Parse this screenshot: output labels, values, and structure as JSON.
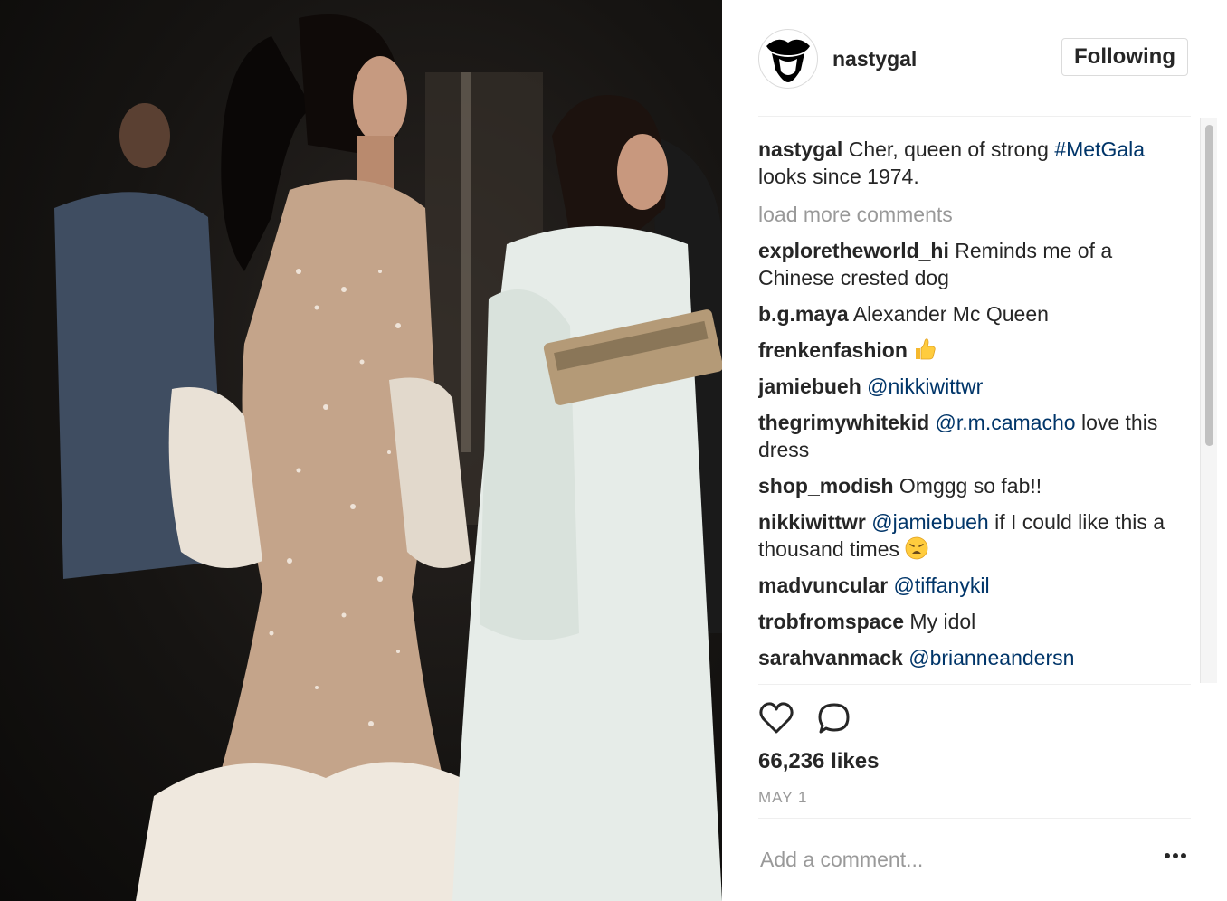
{
  "post": {
    "image_alt": "Photo of two women in evening gowns at a gala",
    "author": "nastygal",
    "follow_label": "Following"
  },
  "caption": {
    "user": "nastygal",
    "text_before": " Cher, queen of strong ",
    "hashtag": "#MetGala",
    "text_after": " looks since 1974."
  },
  "load_more": "load more comments",
  "comments": [
    {
      "user": "exploretheworld_hi",
      "text": " Reminds me of a Chinese crested dog"
    },
    {
      "user": "b.g.maya",
      "text": " Alexander Mc Queen"
    },
    {
      "user": "frenkenfashion",
      "text": " ",
      "emoji": "thumbs-up"
    },
    {
      "user": "jamiebueh",
      "mention": "@nikkiwittwr"
    },
    {
      "user": "thegrimywhitekid",
      "mention": "@r.m.camacho",
      "text": " love this dress"
    },
    {
      "user": "shop_modish",
      "text": " Omggg so fab!!"
    },
    {
      "user": "nikkiwittwr",
      "mention": "@jamiebueh",
      "text": " if I could like this a thousand times ",
      "emoji": "weary-face"
    },
    {
      "user": "madvuncular",
      "mention": "@tiffanykil"
    },
    {
      "user": "trobfromspace",
      "text": " My idol"
    },
    {
      "user": "sarahvanmack",
      "mention": "@brianneandersn"
    }
  ],
  "likes": "66,236 likes",
  "date": "MAY 1",
  "add_comment_placeholder": "Add a comment...",
  "more_glyph": "•••",
  "icons": {
    "like": "heart-icon",
    "comment": "comment-icon",
    "more": "more-options-icon",
    "thumbs": "thumbs-up-icon",
    "weary": "weary-face-icon"
  },
  "colors": {
    "text": "#262626",
    "link": "#003569",
    "muted": "#999999",
    "border": "#dbdbdb"
  }
}
